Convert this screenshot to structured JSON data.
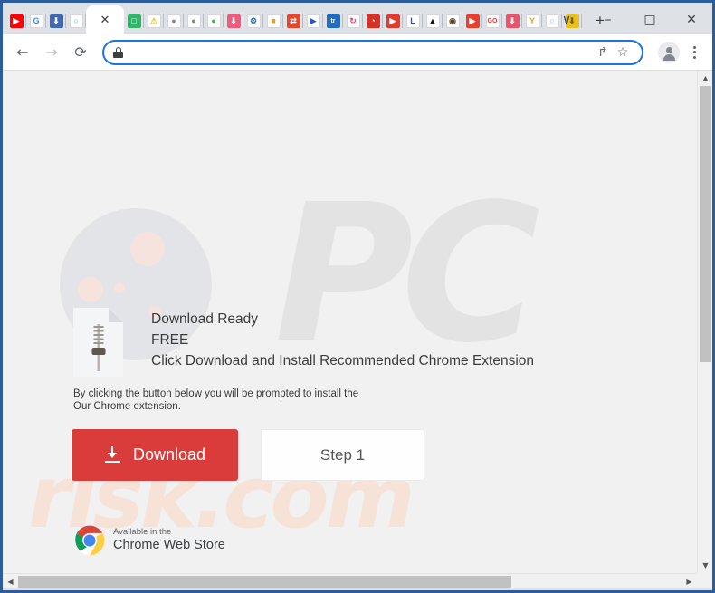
{
  "window": {
    "controls": [
      {
        "name": "tab-search",
        "glyph": "∨"
      },
      {
        "name": "minimize",
        "glyph": "–"
      },
      {
        "name": "maximize",
        "glyph": "□"
      },
      {
        "name": "close",
        "glyph": "✕"
      }
    ]
  },
  "tabstrip": {
    "new_tab_label": "+",
    "active_tab_close": "✕",
    "tabs": [
      {
        "icon": "youtube-icon",
        "bg": "#ff0000",
        "fg": "#ffffff",
        "glyph": "▶"
      },
      {
        "icon": "google-icon",
        "bg": "#ffffff",
        "fg": "#4285f4",
        "glyph": "G"
      },
      {
        "icon": "download-blue-icon",
        "bg": "#4267b2",
        "fg": "#ffffff",
        "glyph": "⬇"
      },
      {
        "icon": "cloud-upload-icon",
        "bg": "#ffffff",
        "fg": "#5b9bd5",
        "glyph": "○"
      },
      {
        "icon": "active-tab",
        "bg": "#ffffff",
        "fg": "#3c4043",
        "glyph": "✕",
        "active": true
      },
      {
        "icon": "green-square-icon",
        "bg": "#32b567",
        "fg": "#ffffff",
        "glyph": "□"
      },
      {
        "icon": "warning-triangle-icon",
        "bg": "#ffffff",
        "fg": "#f5c518",
        "glyph": "⚠"
      },
      {
        "icon": "globe-grey-icon",
        "bg": "#ffffff",
        "fg": "#888888",
        "glyph": "●"
      },
      {
        "icon": "globe-grey-2-icon",
        "bg": "#ffffff",
        "fg": "#888888",
        "glyph": "●"
      },
      {
        "icon": "chrome-icon",
        "bg": "#ffffff",
        "fg": "#4caf50",
        "glyph": "●"
      },
      {
        "icon": "download-pink-icon",
        "bg": "#ef5b7b",
        "fg": "#ffffff",
        "glyph": "⬇"
      },
      {
        "icon": "gear-icon",
        "bg": "#ffffff",
        "fg": "#2b6cb0",
        "glyph": "⚙"
      },
      {
        "icon": "yellow-media-icon",
        "bg": "#ffffff",
        "fg": "#d6a419",
        "glyph": "■"
      },
      {
        "icon": "red-swap-icon",
        "bg": "#e8452c",
        "fg": "#ffffff",
        "glyph": "⇄"
      },
      {
        "icon": "blue-play-icon",
        "bg": "#ffffff",
        "fg": "#2b55c4",
        "glyph": "▶"
      },
      {
        "icon": "tr-icon",
        "bg": "#1e6bbf",
        "fg": "#ffffff",
        "glyph": "tr"
      },
      {
        "icon": "pink-sync-icon",
        "bg": "#ffffff",
        "fg": "#e8417a",
        "glyph": "↻"
      },
      {
        "icon": "red-clock-icon",
        "bg": "#d93025",
        "fg": "#ffffff",
        "glyph": "◔"
      },
      {
        "icon": "red-video-icon",
        "bg": "#e23b2e",
        "fg": "#ffffff",
        "glyph": "▶"
      },
      {
        "icon": "letter-l-icon",
        "bg": "#ffffff",
        "fg": "#2b55c4",
        "glyph": "L"
      },
      {
        "icon": "black-triangle-icon",
        "bg": "#ffffff",
        "fg": "#111111",
        "glyph": "▲"
      },
      {
        "icon": "target-icon",
        "bg": "#ffffff",
        "fg": "#5a4528",
        "glyph": "◉"
      },
      {
        "icon": "red-play-icon",
        "bg": "#e8402c",
        "fg": "#ffffff",
        "glyph": "▶"
      },
      {
        "icon": "go-icon",
        "bg": "#ffffff",
        "fg": "#e03a2f",
        "glyph": "GO"
      },
      {
        "icon": "download-red-icon",
        "bg": "#e8556a",
        "fg": "#ffffff",
        "glyph": "⬇"
      },
      {
        "icon": "ym-icon",
        "bg": "#ffffff",
        "fg": "#e8a020",
        "glyph": "Y"
      },
      {
        "icon": "cloud-arrow-icon",
        "bg": "#ffffff",
        "fg": "#7ba8d9",
        "glyph": "○"
      },
      {
        "icon": "download-yellow-icon",
        "bg": "#e8c120",
        "fg": "#7a6200",
        "glyph": "⬇"
      }
    ]
  },
  "toolbar": {
    "back_icon": "←",
    "forward_icon": "→",
    "reload_icon": "⟳",
    "share_icon": "↱",
    "bookmark_icon": "☆",
    "url_value": "",
    "url_placeholder": "",
    "lock_icon": "lock-icon"
  },
  "page": {
    "watermark_top": "PC",
    "watermark_bottom": "risk.com",
    "headline1": "Download Ready",
    "headline2": "FREE",
    "headline3": "Click Download and Install Recommended Chrome Extension",
    "subtext1": "By clicking the button below you will be prompted to install the",
    "subtext2": "Our Chrome extension.",
    "download_button_label": "Download",
    "step_button_label": "Step 1",
    "cws_line1": "Available in the",
    "cws_line2": "Chrome Web Store",
    "colors": {
      "download_button_bg": "#da3b3b",
      "page_bg": "#f1f1f1",
      "text": "#3c3c3c",
      "watermark_grey": "#e3e3e3",
      "watermark_pink": "#f7e2d8"
    }
  },
  "scrollbars": {
    "up_arrow": "▲",
    "down_arrow": "▼",
    "left_arrow": "◀",
    "right_arrow": "▶"
  }
}
